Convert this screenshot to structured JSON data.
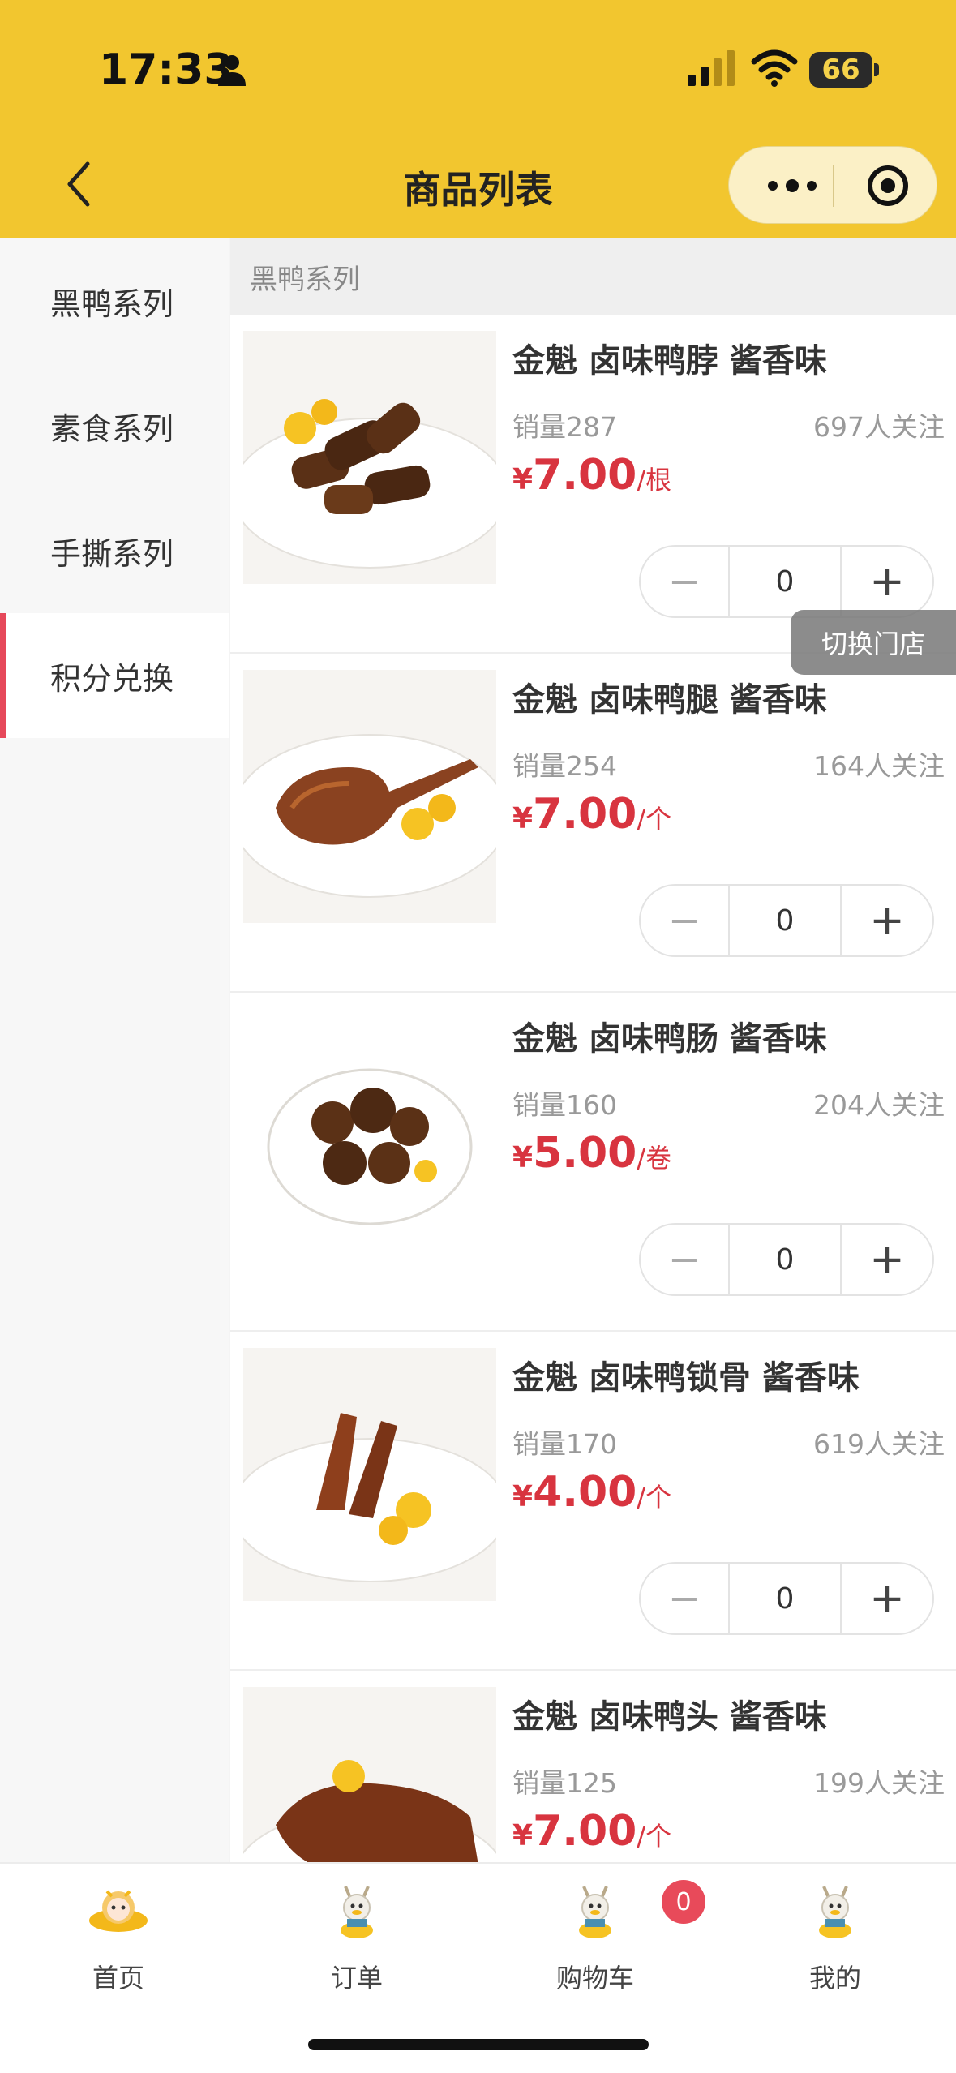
{
  "status_bar": {
    "time": "17:33",
    "battery": "66",
    "icons": [
      "person-icon",
      "signal-icon",
      "wifi-icon",
      "battery-icon"
    ]
  },
  "header": {
    "title": "商品列表",
    "back_icon": "chevron-left-icon",
    "capsule_icons": [
      "more-dots-icon",
      "close-target-icon"
    ],
    "color": "#f2c62f"
  },
  "sidebar": {
    "items": [
      {
        "label": "黑鸭系列",
        "active": false
      },
      {
        "label": "素食系列",
        "active": false
      },
      {
        "label": "手撕系列",
        "active": false
      },
      {
        "label": "积分兑换",
        "active": true
      }
    ],
    "active_color": "#e6485a"
  },
  "section": {
    "title": "黑鸭系列"
  },
  "products": [
    {
      "name": "金魁 卤味鸭脖 酱香味",
      "sales": "销量287",
      "follow": "697人关注",
      "currency": "¥",
      "price": "7.00",
      "unit": "/根",
      "qty": "0"
    },
    {
      "name": "金魁 卤味鸭腿 酱香味",
      "sales": "销量254",
      "follow": "164人关注",
      "currency": "¥",
      "price": "7.00",
      "unit": "/个",
      "qty": "0"
    },
    {
      "name": "金魁 卤味鸭肠 酱香味",
      "sales": "销量160",
      "follow": "204人关注",
      "currency": "¥",
      "price": "5.00",
      "unit": "/卷",
      "qty": "0"
    },
    {
      "name": "金魁 卤味鸭锁骨 酱香味",
      "sales": "销量170",
      "follow": "619人关注",
      "currency": "¥",
      "price": "4.00",
      "unit": "/个",
      "qty": "0"
    },
    {
      "name": "金魁 卤味鸭头 酱香味",
      "sales": "销量125",
      "follow": "199人关注",
      "currency": "¥",
      "price": "7.00",
      "unit": "/个",
      "qty": ""
    }
  ],
  "stepper": {
    "minus": "−",
    "plus": "+"
  },
  "switch_store": "切换门店",
  "tabbar": {
    "tabs": [
      {
        "label": "首页",
        "icon": "home-mascot-icon"
      },
      {
        "label": "订单",
        "icon": "order-mascot-icon"
      },
      {
        "label": "购物车",
        "icon": "cart-mascot-icon"
      },
      {
        "label": "我的",
        "icon": "profile-mascot-icon"
      }
    ],
    "cart_badge": "0"
  },
  "price_color": "#d8343f"
}
